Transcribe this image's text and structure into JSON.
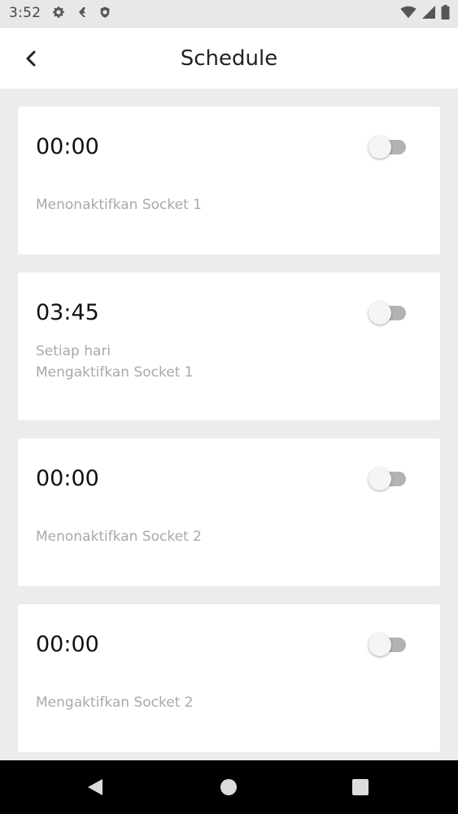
{
  "status_bar": {
    "time": "3:52",
    "icons_left": [
      "settings-icon",
      "flash-icon",
      "shield-icon"
    ],
    "icons_right": [
      "wifi-icon",
      "signal-icon",
      "battery-icon"
    ]
  },
  "app_bar": {
    "title": "Schedule",
    "back_icon": "back-arrow-icon"
  },
  "schedules": [
    {
      "time": "00:00",
      "repeat": "",
      "action": "Menonaktifkan Socket 1",
      "enabled": false
    },
    {
      "time": "03:45",
      "repeat": "Setiap hari",
      "action": "Mengaktifkan Socket 1",
      "enabled": false
    },
    {
      "time": "00:00",
      "repeat": "",
      "action": "Menonaktifkan Socket 2",
      "enabled": false
    },
    {
      "time": "00:00",
      "repeat": "",
      "action": "Mengaktifkan Socket 2",
      "enabled": false
    }
  ],
  "colors": {
    "background": "#ececec",
    "card": "#ffffff",
    "toggle_off_track": "#b3b3b3",
    "toggle_off_thumb": "#f5f5f5",
    "secondary_text": "#a9a9a9"
  },
  "nav_bar": {
    "icons": [
      "nav-back-icon",
      "nav-home-icon",
      "nav-recents-icon"
    ]
  }
}
